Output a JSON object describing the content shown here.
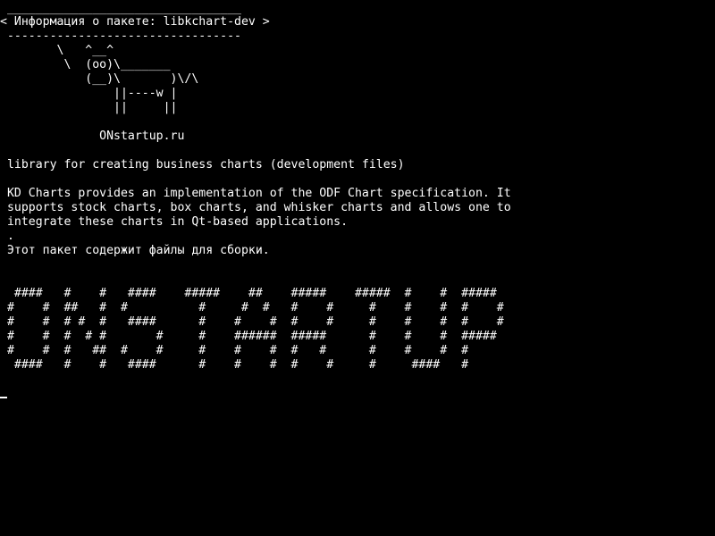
{
  "terminal": {
    "bubble_top": " _________________________________ ",
    "bubble_text": "< Информация о пакете: libkchart-dev >",
    "bubble_bottom": " --------------------------------- ",
    "cow": [
      "        \\   ^__^",
      "         \\  (oo)\\_______",
      "            (__)\\       )\\/\\",
      "                ||----w |",
      "                ||     ||"
    ],
    "site": "              ONstartup.ru",
    "summary": " library for creating business charts (development files)",
    "description": [
      " KD Charts provides an implementation of the ODF Chart specification. It",
      " supports stock charts, box charts, and whisker charts and allows one to",
      " integrate these charts in Qt-based applications.",
      " .",
      " Этот пакет содержит файлы для сборки."
    ],
    "banner": [
      "  ####   #    #   ####    #####    ##    #####    #####  #    #  #####",
      " #    #  ##   #  #          #     #  #   #    #     #    #    #  #    #",
      " #    #  # #  #   ####      #    #    #  #    #     #    #    #  #    #",
      " #    #  #  # #       #     #    ######  #####      #    #    #  #####",
      " #    #  #   ##  #    #     #    #    #  #   #      #    #    #  #",
      "  ####   #    #   ####      #    #    #  #    #     #     ####   #"
    ],
    "colors": {
      "background": "#000000",
      "foreground": "#ffffff"
    }
  }
}
